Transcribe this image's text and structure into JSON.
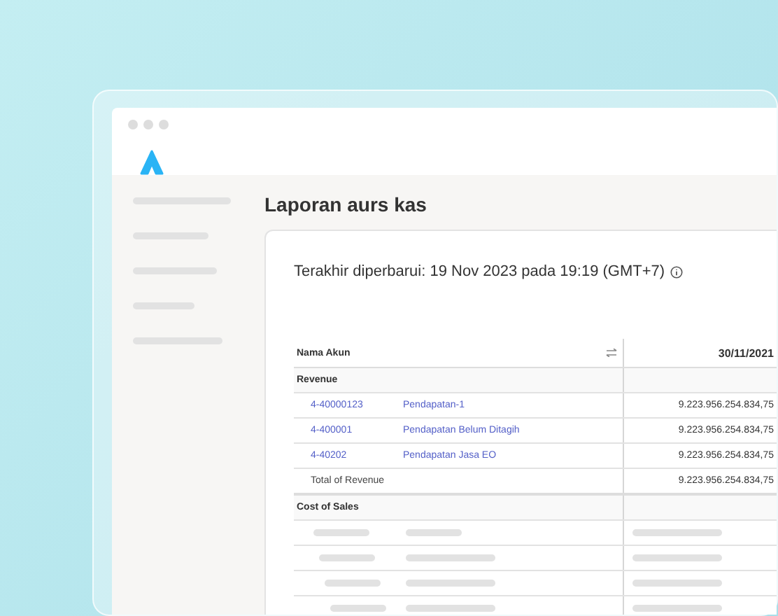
{
  "window": {
    "title": "Laporan aurs kas"
  },
  "sidebar": {
    "items": [
      {
        "kind": "placeholder"
      },
      {
        "kind": "placeholder"
      },
      {
        "kind": "placeholder"
      },
      {
        "kind": "placeholder"
      },
      {
        "kind": "placeholder"
      }
    ]
  },
  "report": {
    "updated": "Terakhir diperbarui: 19 Nov 2023 pada 19:19 (GMT+7)",
    "columns": [
      "Nama Akun",
      "30/11/2021"
    ],
    "rows": [
      {
        "kind": "section",
        "label": "Revenue"
      },
      {
        "kind": "account",
        "code": "4-40000123",
        "name": "Pendapatan-1",
        "value": "9.223.956.254.834,75"
      },
      {
        "kind": "account",
        "code": "4-400001",
        "name": "Pendapatan Belum Ditagih",
        "value": "9.223.956.254.834,75"
      },
      {
        "kind": "account",
        "code": "4-40202",
        "name": "Pendapatan Jasa EO",
        "value": "9.223.956.254.834,75"
      },
      {
        "kind": "total",
        "label": "Total of Revenue",
        "value": "9.223.956.254.834,75"
      },
      {
        "kind": "section",
        "label": "Cost of Sales"
      },
      {
        "kind": "placeholder"
      },
      {
        "kind": "placeholder"
      },
      {
        "kind": "placeholder"
      },
      {
        "kind": "placeholder"
      }
    ]
  }
}
